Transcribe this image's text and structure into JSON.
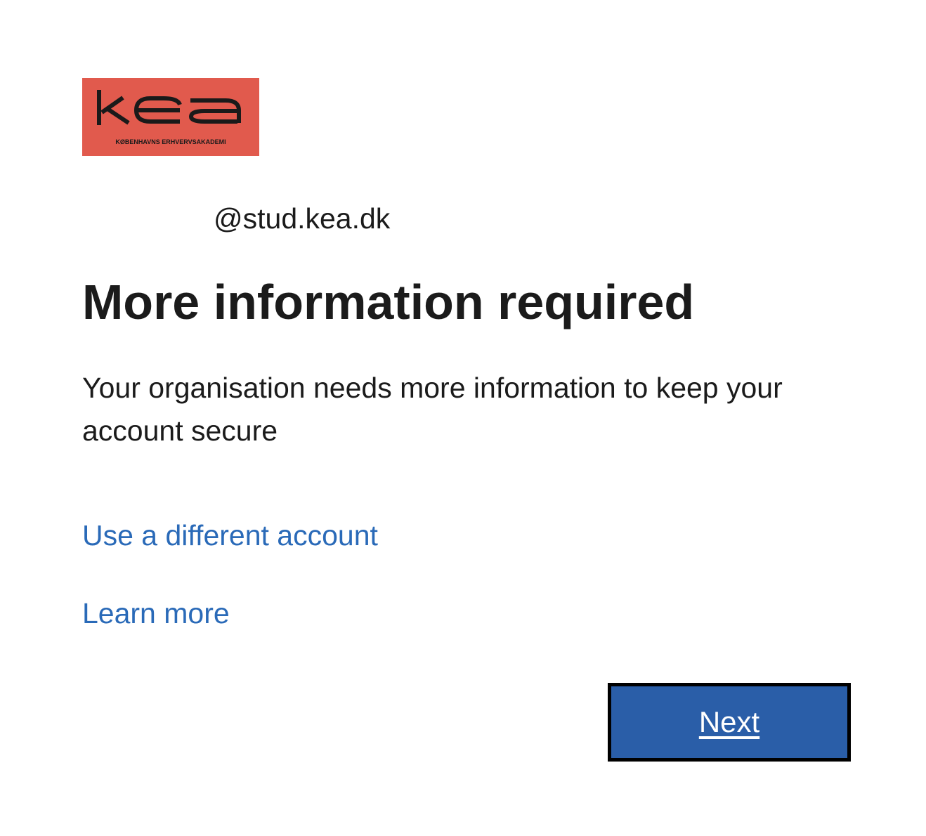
{
  "branding": {
    "logo_text": "kea",
    "logo_subtitle": "KØBENHAVNS ERHVERVSAKADEMI",
    "logo_background": "#e15a4d"
  },
  "account": {
    "email": "@stud.kea.dk"
  },
  "header": {
    "title": "More information required"
  },
  "body": {
    "description": "Your organisation needs more information to keep your account secure"
  },
  "links": {
    "different_account": "Use a different account",
    "learn_more": "Learn more"
  },
  "actions": {
    "next_label": "Next"
  },
  "colors": {
    "link": "#2a6ab8",
    "primary_button": "#2a5ea8",
    "text": "#1b1b1b"
  }
}
